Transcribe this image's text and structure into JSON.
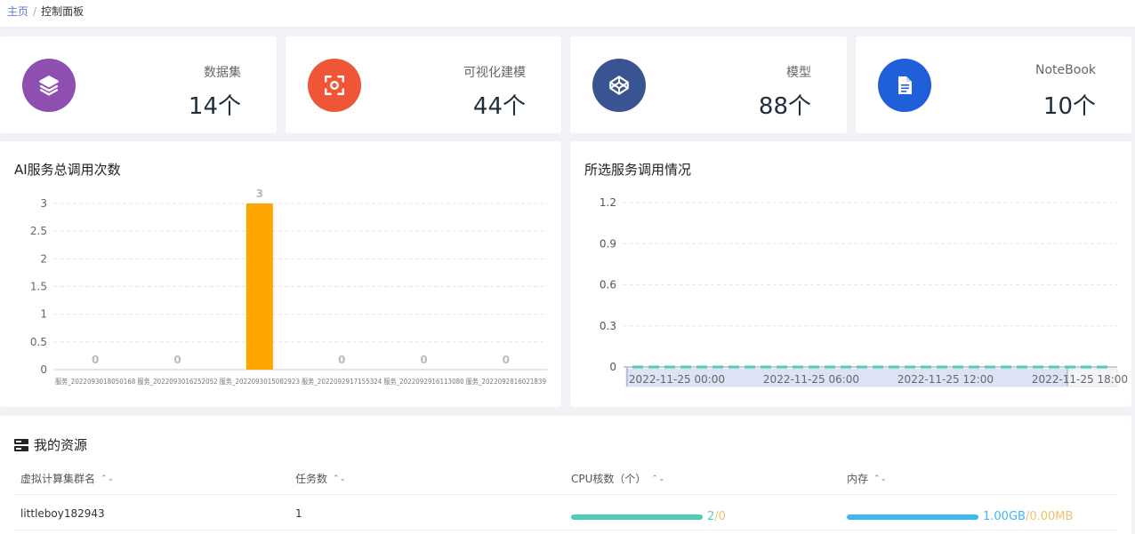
{
  "breadcrumb": {
    "home": "主页",
    "sep": "/",
    "current": "控制面板"
  },
  "stats": [
    {
      "label": "数据集",
      "value": "14个",
      "color": "#8e4fb0",
      "icon": "layers-icon"
    },
    {
      "label": "可视化建模",
      "value": "44个",
      "color": "#ef5537",
      "icon": "scan-icon"
    },
    {
      "label": "模型",
      "value": "88个",
      "color": "#3a5491",
      "icon": "codepen-icon"
    },
    {
      "label": "NoteBook",
      "value": "10个",
      "color": "#1f5fd9",
      "icon": "document-icon"
    }
  ],
  "chart_data": [
    {
      "type": "bar",
      "title": "AI服务总调用次数",
      "categories": [
        "服务_2022093018050168",
        "服务_2022093016252052",
        "服务_2022093015082923",
        "服务_2022092917155324",
        "服务_2022092916113080",
        "服务_2022092816021839"
      ],
      "category_labels": [
        "服务_20220930180501​6",
        "服务_202209301625205",
        "服务_202209301508292",
        "服务_202209291715532",
        "服务_20220929161130",
        "服务_2022092816021839"
      ],
      "values": [
        0,
        0,
        3,
        0,
        0,
        0
      ],
      "yticks": [
        "0",
        "0.5",
        "1",
        "1.5",
        "2",
        "2.5",
        "3"
      ],
      "ylim": [
        0,
        3
      ],
      "bar_color": "#ffa500",
      "grid": true
    },
    {
      "type": "line",
      "title": "所选服务调用情况",
      "yticks": [
        "0",
        "0.3",
        "0.6",
        "0.9",
        "1.2"
      ],
      "ylim": [
        0,
        1.2
      ],
      "xticks": [
        "2022-11-25 00:00",
        "2022-11-25 06:00",
        "2022-11-25 12:00",
        "2022-11-25 18:00"
      ],
      "series": [
        {
          "values": [
            0,
            0,
            0,
            0,
            0,
            0,
            0,
            0,
            0,
            0,
            0,
            0,
            0,
            0,
            0,
            0,
            0,
            0,
            0,
            0,
            0,
            0,
            0,
            0
          ]
        }
      ],
      "line_color": "#4ecdb8",
      "grid": true
    }
  ],
  "resources": {
    "title": "我的资源",
    "columns": [
      "虚拟计算集群名",
      "任务数",
      "CPU核数（个）",
      "内存"
    ],
    "rows": [
      {
        "name": "littleboy182943",
        "tasks": "1",
        "cpu_used": "2",
        "cpu_sep": "/",
        "cpu_free": "0",
        "cpu_ratio": 1.0,
        "mem_used": "1.00GB",
        "mem_sep": "/",
        "mem_free": "0.00MB",
        "mem_ratio": 1.0
      }
    ],
    "colors": {
      "cpu_bar": "#4ecdb8",
      "mem_bar": "#3fb6f2",
      "free_text": "#f5c06a"
    }
  }
}
